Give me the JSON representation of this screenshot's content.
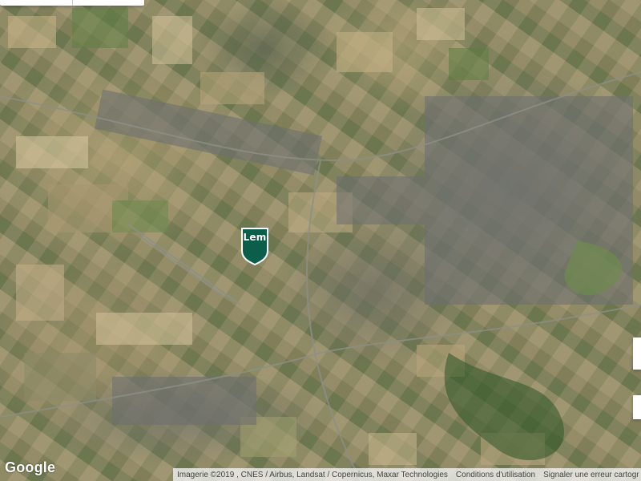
{
  "map": {
    "type": "satellite",
    "marker": {
      "label": "Lem",
      "color": "#0b5e4a"
    },
    "logo": "Google",
    "attribution": {
      "imagery": "Imagerie ©2019 , CNES / Airbus, Landsat / Copernicus, Maxar Technologies",
      "terms": "Conditions d'utilisation",
      "report": "Signaler une erreur cartogr"
    }
  }
}
